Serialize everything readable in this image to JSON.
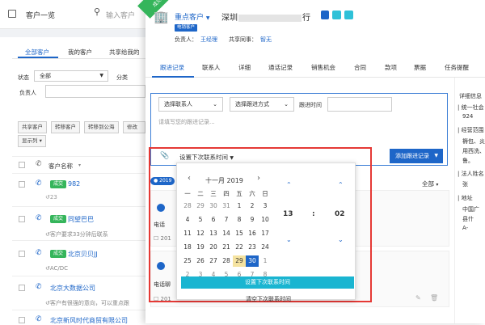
{
  "list": {
    "title": "客户一览",
    "search_placeholder": "输入客户",
    "tabs": [
      "全部客户",
      "我的客户",
      "共享给我的"
    ],
    "filter_status_label": "状态",
    "filter_status_value": "全部",
    "filter_category_label": "分类",
    "filter_owner_label": "负责人",
    "actions": [
      "共享客户",
      "转移客户",
      "转移到公海",
      "修改"
    ],
    "display_cols": "显示列",
    "col_name": "客户名称",
    "rows": [
      {
        "badge": "成交",
        "name": "982",
        "note": "",
        "tag": ""
      },
      {
        "badge": "成交",
        "name": "同望巴巴",
        "note": "客户要求33分钟后联系",
        "tag": ""
      },
      {
        "badge": "成交",
        "name": "北京贝贝JJ",
        "note": "AC/DC",
        "tag": ""
      },
      {
        "badge": "",
        "name": "北京大数据公司",
        "note": "客户有很强的意向，可以重点跟",
        "tag": ""
      },
      {
        "badge": "",
        "name": "北京新风时代商贸有限公司",
        "note": "",
        "tag": ""
      }
    ]
  },
  "panel": {
    "corner_ribbon": "成交",
    "customer_type": "重点客户",
    "company": "深圳",
    "company_tail": "行",
    "tag": "电销客户",
    "owner_label": "负责人：",
    "owner": "王经理",
    "share_label": "共享同事：",
    "share": "智无",
    "tabs": [
      "跟进记录",
      "联系人",
      "详细",
      "通话记录",
      "销售机会",
      "合同",
      "款项",
      "票据",
      "任务提醒"
    ],
    "select_contact": "选择联系人",
    "select_method": "选择跟进方式",
    "follow_time_label": "跟进时间",
    "follow_placeholder": "请填写您的跟进记录...",
    "next_contact": "设置下次联系时间",
    "add_record": "添加跟进记录",
    "filter_all": "全部",
    "timeline_year": "2019",
    "contact_label": "电话",
    "contact_label2": "电话聊",
    "timeline_items": [
      "201",
      "201",
      "201"
    ],
    "right_title": "详细信息",
    "right_items": [
      "统一社会",
      "924",
      "经营范围",
      "褥包、炎",
      "用西洗、",
      "鲁。",
      "法人姓名",
      "张",
      "地址",
      "中国广",
      "县什",
      "A-"
    ]
  },
  "calendar": {
    "month_label": "十一月 2019",
    "weekdays": [
      "一",
      "二",
      "三",
      "四",
      "五",
      "六",
      "日"
    ],
    "days": [
      [
        "28",
        "29",
        "30",
        "31",
        "1",
        "2",
        "3"
      ],
      [
        "4",
        "5",
        "6",
        "7",
        "8",
        "9",
        "10"
      ],
      [
        "11",
        "12",
        "13",
        "14",
        "15",
        "16",
        "17"
      ],
      [
        "18",
        "19",
        "20",
        "21",
        "22",
        "23",
        "24"
      ],
      [
        "25",
        "26",
        "27",
        "28",
        "29",
        "30",
        "1"
      ],
      [
        "2",
        "3",
        "4",
        "5",
        "6",
        "7",
        "8"
      ]
    ],
    "today": "29",
    "selected": "30",
    "hour": "13",
    "separator": ":",
    "minute": "02",
    "confirm": "设置下次联系时间",
    "clear": "清空下次联系时间"
  },
  "colors": {
    "brand": "#1e66c8",
    "success": "#35b55b",
    "highlight": "#e53935",
    "today": "#f5e3a0",
    "confirm": "#1ab5d1"
  }
}
